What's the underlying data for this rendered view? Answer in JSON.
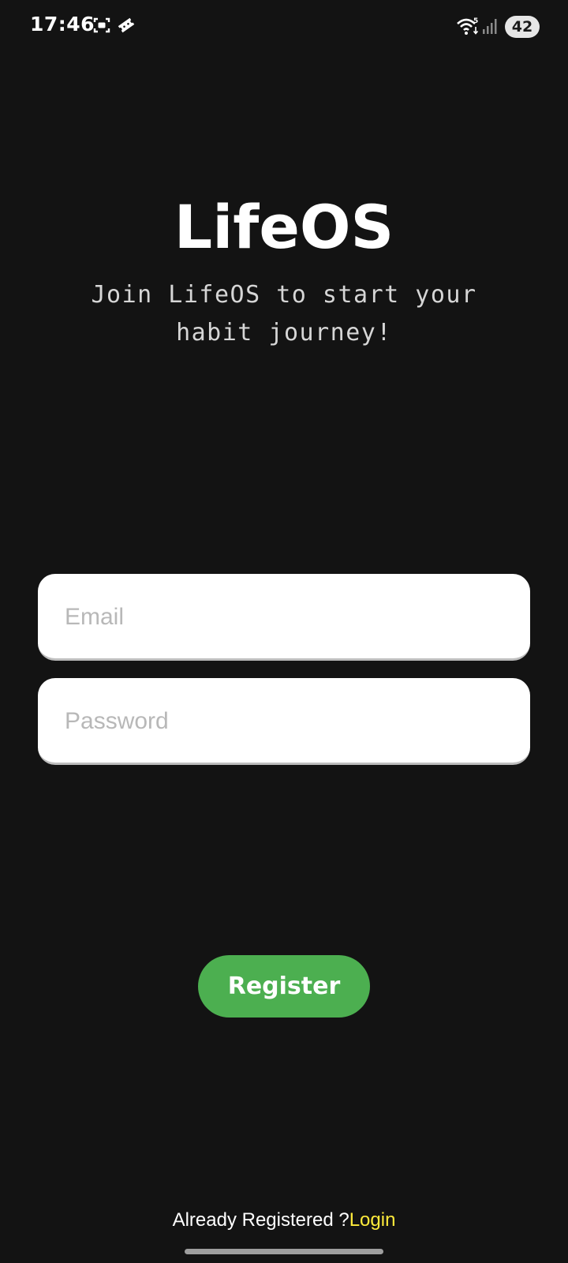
{
  "status_bar": {
    "time": "17:46",
    "icons": [
      "screenshot-icon",
      "ticket-icon",
      "wifi-icon",
      "signal-icon"
    ],
    "battery": "42"
  },
  "header": {
    "title": "LifeOS",
    "subtitle": "Join LifeOS to start your habit journey!"
  },
  "form": {
    "email_placeholder": "Email",
    "email_value": "",
    "password_placeholder": "Password",
    "password_value": "",
    "register_label": "Register"
  },
  "footer": {
    "prompt": "Already Registered ?",
    "login_label": "Login"
  },
  "colors": {
    "background": "#131313",
    "button": "#4caf50",
    "login_link": "#ffeb3b"
  }
}
